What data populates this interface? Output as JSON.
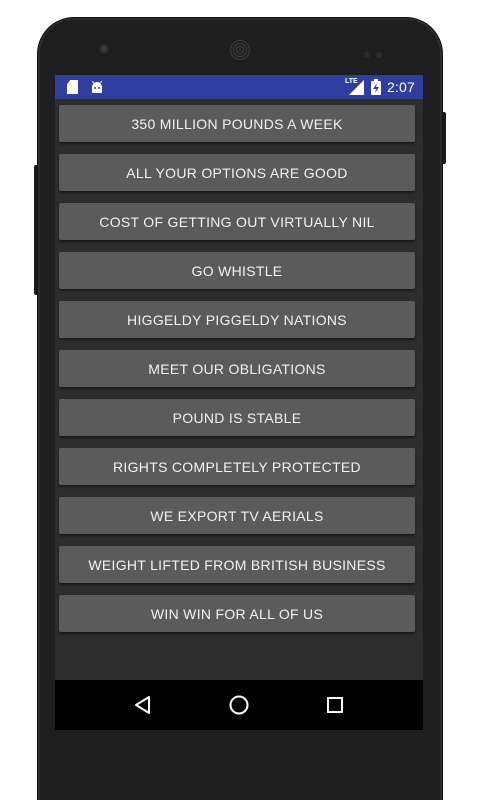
{
  "status_bar": {
    "network_label": "LTE",
    "time": "2:07",
    "color": "#303f9f",
    "icons": [
      "sd-card-icon",
      "android-debug-icon",
      "lte-signal-icon",
      "battery-charging-icon"
    ]
  },
  "buttons": [
    {
      "label": "350 MILLION POUNDS A WEEK"
    },
    {
      "label": "ALL YOUR OPTIONS ARE GOOD"
    },
    {
      "label": "COST OF GETTING OUT VIRTUALLY NIL"
    },
    {
      "label": "GO WHISTLE"
    },
    {
      "label": "HIGGELDY PIGGELDY NATIONS"
    },
    {
      "label": "MEET OUR OBLIGATIONS"
    },
    {
      "label": "POUND IS STABLE"
    },
    {
      "label": "RIGHTS COMPLETELY PROTECTED"
    },
    {
      "label": "WE EXPORT TV AERIALS"
    },
    {
      "label": "WEIGHT LIFTED FROM BRITISH BUSINESS"
    },
    {
      "label": "WIN WIN FOR ALL OF US"
    }
  ],
  "nav_bar": {
    "icons": [
      "back-icon",
      "home-icon",
      "recents-icon"
    ]
  },
  "colors": {
    "screen_background": "#2d2d2d",
    "button_background": "#5b5b5b",
    "button_text": "#f2f2f2"
  }
}
